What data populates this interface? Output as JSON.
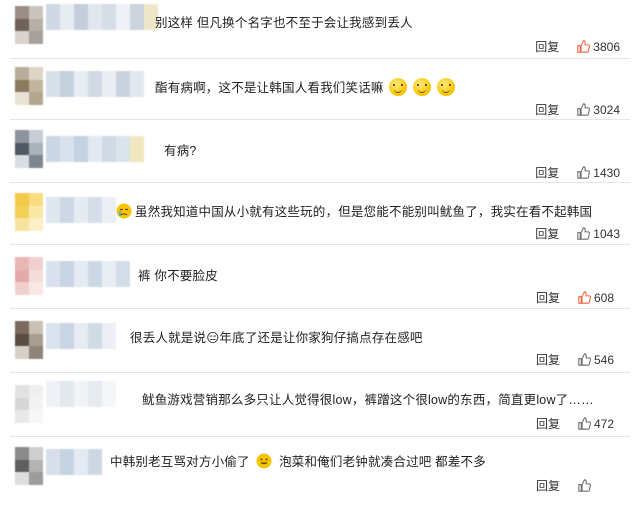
{
  "comments": [
    {
      "text": "别这样 但凡换个名字也不至于会让我感到丢人",
      "reply": "回复",
      "likes": "3806",
      "liked": true
    },
    {
      "text": "酯有病啊，这不是让韩国人看我们笑话嘛",
      "reply": "回复",
      "likes": "3024",
      "liked": false
    },
    {
      "text": "有病?",
      "reply": "回复",
      "likes": "1430",
      "liked": false
    },
    {
      "text": "虽然我知道中国从小就有这些玩的，但是您能不能别叫鱿鱼了，我实在看不起韩国",
      "reply": "回复",
      "likes": "1043",
      "liked": false
    },
    {
      "text": "裤 你不要脸皮",
      "reply": "回复",
      "likes": "608",
      "liked": true
    },
    {
      "text": "很丢人就是说😑年底了还是让你家狗仔搞点存在感吧",
      "reply": "回复",
      "likes": "546",
      "liked": false
    },
    {
      "text": "鱿鱼游戏营销那么多只让人觉得很low，裤蹭这个很low的东西，简直更low了……",
      "reply": "回复",
      "likes": "472",
      "liked": false
    },
    {
      "text": "中韩别老互骂对方小偷了",
      "text_after": "泡菜和俺们老钟就凑合过吧 都差不多",
      "reply": "回复",
      "likes": "",
      "liked": false
    }
  ],
  "icons": {
    "thumb": "thumbs-up-icon",
    "emoji_smile": "smile-emoji-icon",
    "emoji_cry": "cry-emoji-icon",
    "emoji_grin": "grin-emoji-icon"
  },
  "colors": {
    "liked": "#f0623e",
    "normal": "#6b6b6b",
    "divider": "#e6e6e6"
  }
}
